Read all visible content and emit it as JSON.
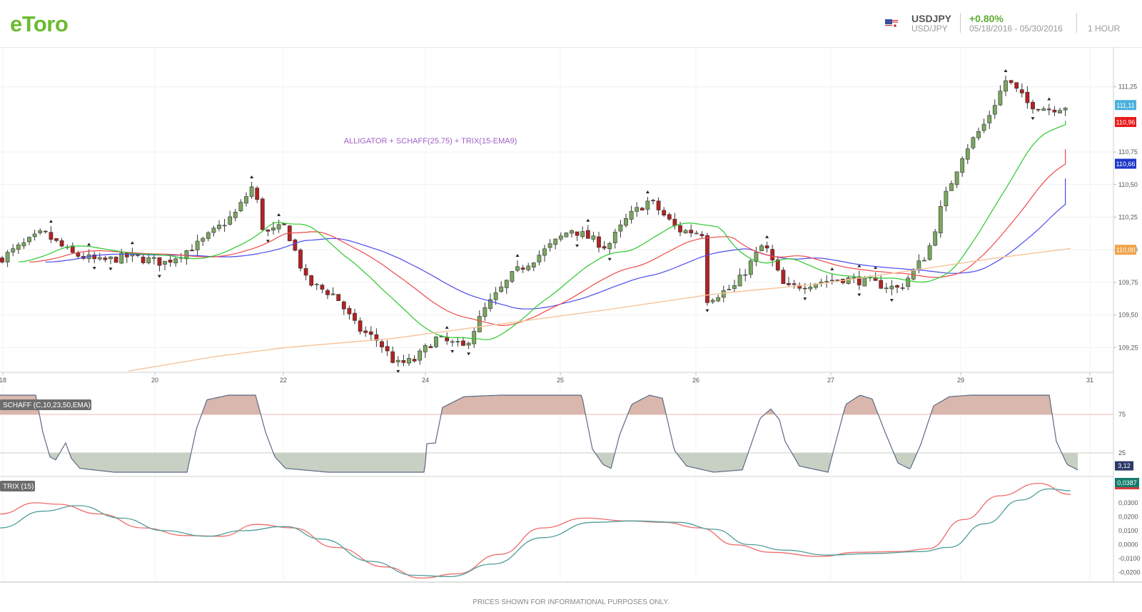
{
  "header": {
    "logo": "eToro",
    "symbol": "USDJPY",
    "symbol_sub": "USD/JPY",
    "change": "+0.80%",
    "date_range": "05/18/2016 - 05/30/2016",
    "timeframe": "1 HOUR",
    "flag_icon": "us-jp-flag-icon"
  },
  "chart_data": [
    {
      "type": "candlestick",
      "annotation": "ALLIGATOR + SCHAFF(25.75) + TRIX(15-EMA9)",
      "xlabels": [
        "18",
        "20",
        "22",
        "24",
        "25",
        "26",
        "27",
        "29",
        "31"
      ],
      "yticks": [
        "109,25",
        "109,50",
        "109,75",
        "110,00",
        "110,25",
        "110,50",
        "110,75",
        "111,25"
      ],
      "ylim": [
        109.06,
        111.5
      ],
      "price_tags": [
        {
          "label": "111,11",
          "value": 111.11,
          "color": "#4ab0de"
        },
        {
          "label": "110,96",
          "value": 110.98,
          "color": "#e8191a"
        },
        {
          "label": "110,66",
          "value": 110.66,
          "color": "#1f37c8"
        },
        {
          "label": "110,00",
          "value": 110.0,
          "color": "#f0a34a"
        }
      ],
      "series": [
        {
          "name": "jaw",
          "color": "#4a4af0"
        },
        {
          "name": "teeth",
          "color": "#ef4a4a"
        },
        {
          "name": "lips",
          "color": "#2dc82d"
        },
        {
          "name": "ma",
          "color": "#f6c49a"
        }
      ],
      "colors": {
        "up": "#7aa660",
        "down": "#b22222"
      }
    },
    {
      "type": "area",
      "label": "SCHAFF (C,10,23,50,EMA)",
      "yticks": [
        "75",
        "25"
      ],
      "ylim": [
        0,
        100
      ],
      "value_tag": "3,12",
      "value_tag_color": "#2b3a66"
    },
    {
      "type": "line",
      "label": "TRIX (15)",
      "yticks": [
        "0,0300",
        "0,0200",
        "0,0100",
        "0,0000",
        "-0,0100",
        "-0,0200"
      ],
      "ylim": [
        -0.0238,
        0.0438
      ],
      "value_tag": "0,0387",
      "value_tag_color": "#137c6e",
      "series": [
        {
          "name": "trix",
          "color": "#ef6b6b"
        },
        {
          "name": "signal",
          "color": "#4e9e9a"
        }
      ]
    }
  ],
  "footer": "PRICES SHOWN FOR INFORMATIONAL PURPOSES ONLY."
}
